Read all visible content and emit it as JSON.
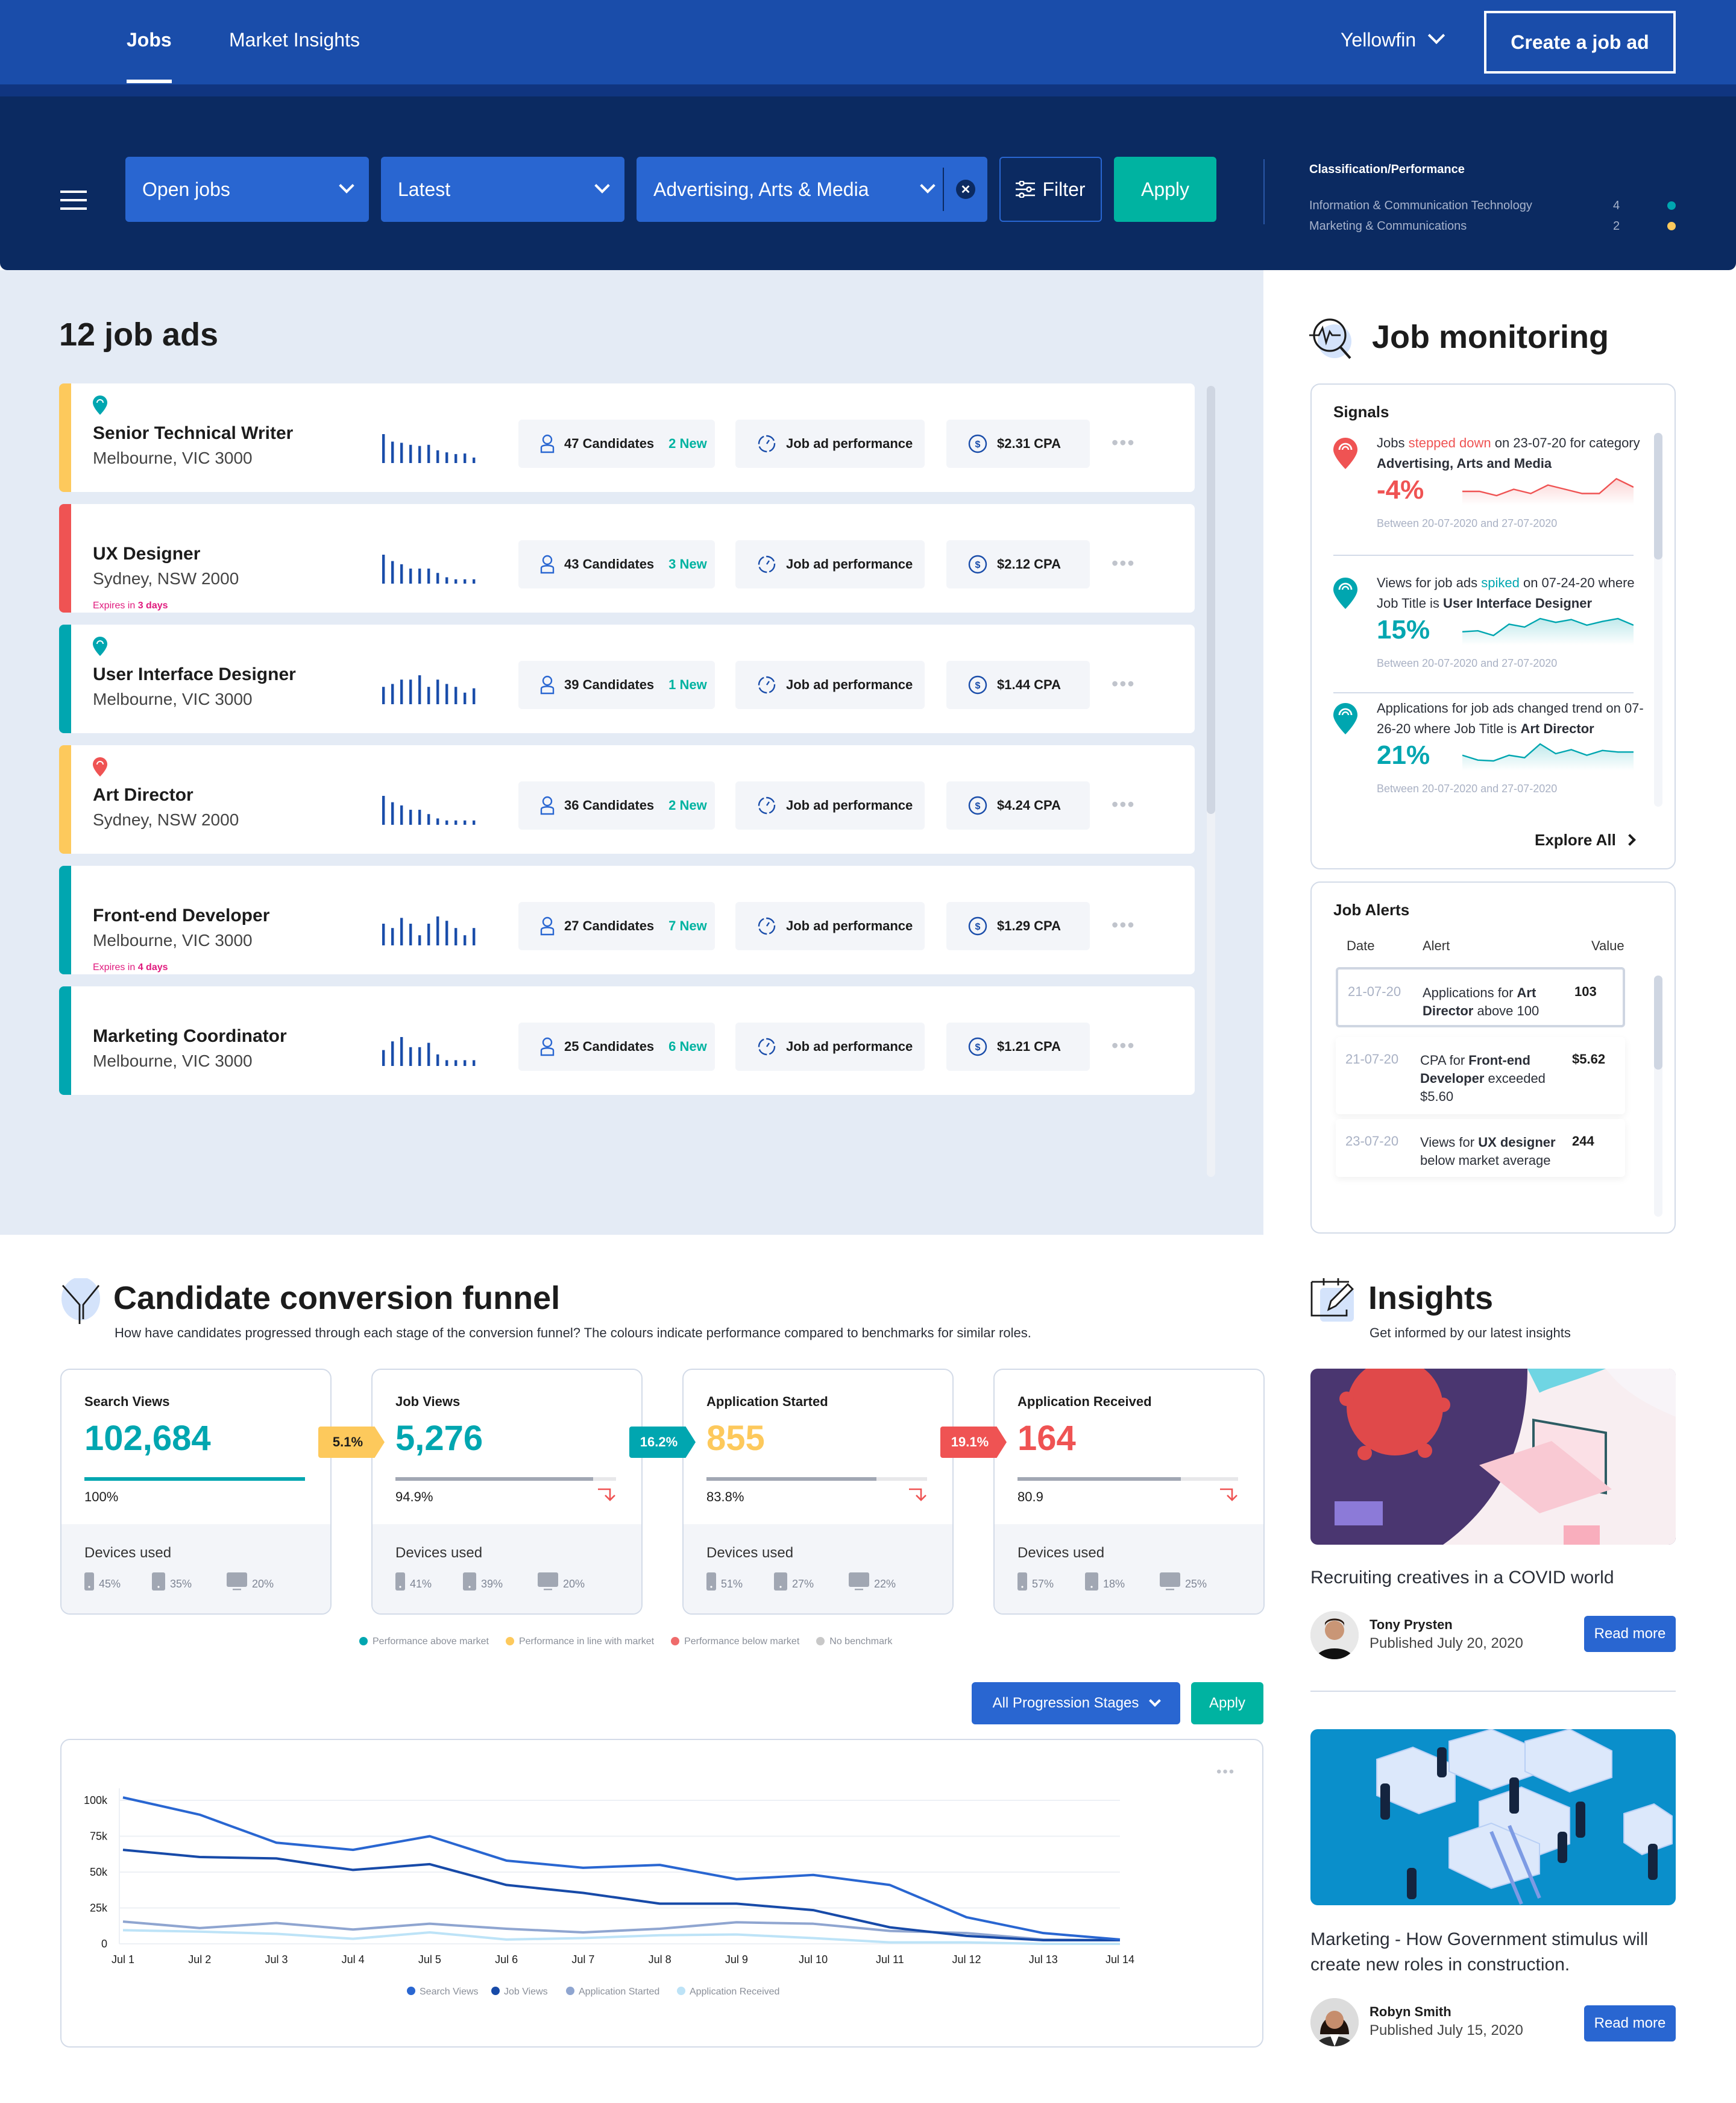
{
  "topnav": {
    "tabs": [
      {
        "label": "Jobs",
        "active": true
      },
      {
        "label": "Market Insights",
        "active": false
      }
    ],
    "account": "Yellowfin",
    "create_button": "Create a job ad"
  },
  "filters": {
    "status": "Open jobs",
    "sort": "Latest",
    "category": "Advertising, Arts & Media",
    "filter_label": "Filter",
    "apply_label": "Apply"
  },
  "classification": {
    "title": "Classification/Performance",
    "rows": [
      {
        "label": "Information & Communication Technology",
        "count": "4",
        "color": "#00a6b0"
      },
      {
        "label": "Marketing & Communications",
        "count": "2",
        "color": "#fdc95c"
      }
    ]
  },
  "jobs": {
    "count_label": "12 job ads",
    "performance_label": "Job ad performance",
    "items": [
      {
        "title": "Senior Technical Writer",
        "location": "Melbourne, VIC 3000",
        "expires_prefix": "",
        "expires_days": "",
        "candidates": "47 Candidates",
        "new": "2 New",
        "cpa": "$2.31 CPA",
        "status_color": "#fdc95c",
        "pin_color": "#00a6b0",
        "bars": [
          1.0,
          0.74,
          0.7,
          0.63,
          0.59,
          0.63,
          0.44,
          0.37,
          0.31,
          0.33,
          0.19
        ]
      },
      {
        "title": "UX Designer",
        "location": "Sydney, NSW 2000",
        "expires_prefix": "Expires in ",
        "expires_days": "3 days",
        "candidates": "43 Candidates",
        "new": "3 New",
        "cpa": "$2.12 CPA",
        "status_color": "#ef5353",
        "pin_color": "",
        "bars": [
          1.0,
          0.78,
          0.67,
          0.52,
          0.52,
          0.52,
          0.37,
          0.22,
          0.15,
          0.15,
          0.15
        ]
      },
      {
        "title": "User Interface Designer",
        "location": "Melbourne, VIC 3000",
        "expires_prefix": "",
        "expires_days": "",
        "candidates": "39 Candidates",
        "new": "1 New",
        "cpa": "$1.44 CPA",
        "status_color": "#00a6b0",
        "pin_color": "#00a6b0",
        "bars": [
          0.6,
          0.7,
          0.85,
          0.85,
          1.0,
          0.6,
          0.85,
          0.7,
          0.6,
          0.4,
          0.55
        ]
      },
      {
        "title": "Art Director",
        "location": "Sydney, NSW 2000",
        "expires_prefix": "",
        "expires_days": "",
        "candidates": "36 Candidates",
        "new": "2 New",
        "cpa": "$4.24 CPA",
        "status_color": "#fdc95c",
        "pin_color": "#ef5353",
        "bars": [
          1.0,
          0.78,
          0.67,
          0.52,
          0.52,
          0.37,
          0.22,
          0.15,
          0.15,
          0.15,
          0.15
        ]
      },
      {
        "title": "Front-end Developer",
        "location": "Melbourne, VIC 3000",
        "expires_prefix": "Expires in ",
        "expires_days": "4 days",
        "candidates": "27 Candidates",
        "new": "7 New",
        "cpa": "$1.29 CPA",
        "status_color": "#00a6b0",
        "pin_color": "",
        "bars": [
          0.75,
          0.6,
          0.95,
          0.75,
          0.35,
          0.75,
          1.0,
          0.85,
          0.6,
          0.35,
          0.6
        ]
      },
      {
        "title": "Marketing Coordinator",
        "location": "Melbourne, VIC 3000",
        "expires_prefix": "",
        "expires_days": "",
        "candidates": "25 Candidates",
        "new": "6 New",
        "cpa": "$1.21 CPA",
        "status_color": "#00a6b0",
        "pin_color": "",
        "bars": [
          0.55,
          0.85,
          1.0,
          0.65,
          0.65,
          0.8,
          0.4,
          0.2,
          0.2,
          0.2,
          0.2
        ]
      }
    ]
  },
  "monitoring": {
    "title": "Job monitoring",
    "signals_title": "Signals",
    "signals": [
      {
        "pre": "Jobs ",
        "hl": "stepped down",
        "mid": " on 23-07-20 for category ",
        "bold": "Advertising, Arts and Media",
        "value": "-4%",
        "color": "#ef5353",
        "between": "Between  20-07-2020 and 27-07-2020",
        "spark": [
          5,
          5,
          3,
          6,
          4,
          8,
          6,
          4,
          4,
          11,
          7
        ]
      },
      {
        "pre": "Views for job ads ",
        "hl": "spiked",
        "mid": " on 07-24-20 where Job Title is ",
        "bold": "User Interface Designer",
        "value": "15%",
        "color": "#00a6b0",
        "between": "Between  20-07-2020 and 27-07-2020",
        "spark": [
          2,
          2.5,
          0,
          6,
          4.5,
          9,
          7,
          8.5,
          5.5,
          7.5,
          9,
          5.5
        ]
      },
      {
        "pre": "Applications for job ads changed trend on 07-26-20 where Job Title is ",
        "hl": "",
        "mid": "",
        "bold": "Art Director",
        "value": "21%",
        "color": "#00a6b0",
        "between": "Between  20-07-2020 and 27-07-2020",
        "spark": [
          5,
          2,
          1.5,
          5,
          3.5,
          12,
          6,
          8.5,
          5,
          8,
          7,
          7
        ]
      }
    ],
    "explore_label": "Explore All",
    "alerts_title": "Job Alerts",
    "alerts_columns": [
      "Date",
      "Alert",
      "Value"
    ],
    "alerts": [
      {
        "date": "21-07-20",
        "pre": "Applications for ",
        "bold": "Art Director",
        "post": " above 100",
        "value": "103"
      },
      {
        "date": "21-07-20",
        "pre": "CPA for ",
        "bold": "Front-end Developer",
        "post": " exceeded $5.60",
        "value": "$5.62"
      },
      {
        "date": "23-07-20",
        "pre": "Views for ",
        "bold": "UX designer",
        "post": " below market average",
        "value": "244"
      }
    ]
  },
  "funnel": {
    "title": "Candidate conversion funnel",
    "subtitle": "How have candidates progressed through each stage of the conversion funnel? The colours indicate performance compared to benchmarks for similar roles.",
    "devices_label": "Devices used",
    "stages": [
      {
        "label": "Search Views",
        "value": "102,684",
        "color": "#00a6b0",
        "pct": "100%",
        "fill": 1.0,
        "bar_color": "#00a6b0",
        "trend": false,
        "devices": [
          "45%",
          "35%",
          "20%"
        ]
      },
      {
        "label": "Job Views",
        "value": "5,276",
        "color": "#00a6b0",
        "pct": "94.9%",
        "fill": 0.895,
        "bar_color": "#a1a7b3",
        "trend": true,
        "devices": [
          "41%",
          "39%",
          "20%"
        ]
      },
      {
        "label": "Application Started",
        "value": "855",
        "color": "#fdc95c",
        "pct": "83.8%",
        "fill": 0.77,
        "bar_color": "#a1a7b3",
        "trend": true,
        "devices": [
          "51%",
          "27%",
          "22%"
        ]
      },
      {
        "label": "Application Received",
        "value": "164",
        "color": "#ef5353",
        "pct": "80.9",
        "fill": 0.74,
        "bar_color": "#a1a7b3",
        "trend": true,
        "devices": [
          "57%",
          "18%",
          "25%"
        ]
      }
    ],
    "conversions": [
      {
        "value": "5.1%",
        "color": "#fdc95c",
        "text_color": "#1c1c1c"
      },
      {
        "value": "16.2%",
        "color": "#00a6b0",
        "text_color": "#ffffff"
      },
      {
        "value": "19.1%",
        "color": "#ef5353",
        "text_color": "#ffffff"
      }
    ],
    "legend": [
      {
        "label": "Performance above market",
        "color": "#00a6b0"
      },
      {
        "label": "Performance in line with market",
        "color": "#fdc95c"
      },
      {
        "label": "Performance below market",
        "color": "#ef6b6b"
      },
      {
        "label": "No benchmark",
        "color": "#c8c8c8"
      }
    ],
    "stage_select": "All Progression Stages",
    "apply_label": "Apply"
  },
  "chart_data": {
    "type": "line",
    "title": "",
    "xlabel": "",
    "ylabel": "",
    "x": [
      "Jul 1",
      "Jul 2",
      "Jul 3",
      "Jul 4",
      "Jul 5",
      "Jul 6",
      "Jul 7",
      "Jul 8",
      "Jul 9",
      "Jul 10",
      "Jul 11",
      "Jul 12",
      "Jul 13",
      "Jul 14"
    ],
    "yticks": [
      "0",
      "25k",
      "50k",
      "75k",
      "100k"
    ],
    "ylim": [
      0,
      100000
    ],
    "grid": true,
    "legend_position": "bottom",
    "series": [
      {
        "name": "Search Views",
        "color": "#2966d1",
        "values": [
          102000,
          90000,
          70500,
          65500,
          75000,
          58000,
          53000,
          55000,
          45000,
          48000,
          41000,
          18500,
          7500,
          3000
        ]
      },
      {
        "name": "Job Views",
        "color": "#174aa8",
        "values": [
          65500,
          60500,
          59500,
          51500,
          55500,
          41000,
          35500,
          28000,
          28000,
          23500,
          11500,
          5500,
          2500,
          2500
        ]
      },
      {
        "name": "Application Started",
        "color": "#8fa5d0",
        "values": [
          15500,
          11000,
          14500,
          10000,
          14000,
          10500,
          8000,
          10500,
          15000,
          14000,
          9000,
          7500,
          3000,
          2500
        ]
      },
      {
        "name": "Application Received",
        "color": "#bde3f7",
        "values": [
          9500,
          8500,
          7000,
          3500,
          8000,
          3000,
          4000,
          6000,
          6500,
          4000,
          1000,
          1000,
          0,
          0
        ]
      }
    ]
  },
  "insights": {
    "title": "Insights",
    "subtitle": "Get informed by our latest insights",
    "articles": [
      {
        "title": "Recruiting creatives in a COVID world",
        "author": "Tony Prysten",
        "published": "Published July 20, 2020",
        "read_more": "Read more"
      },
      {
        "title": "Marketing - How Government stimulus will create new roles in construction.",
        "author": "Robyn Smith",
        "published": "Published July 15, 2020",
        "read_more": "Read more"
      }
    ]
  }
}
